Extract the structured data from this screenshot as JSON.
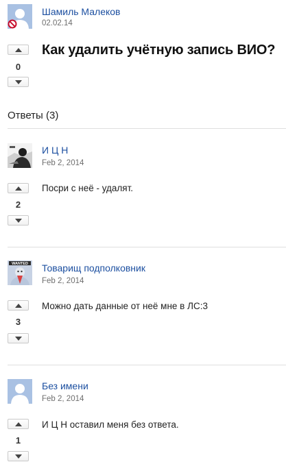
{
  "question": {
    "author": "Шамиль Малеков",
    "date": "02.02.14",
    "votes": "0",
    "title": "Как удалить учётную запись ВИО?"
  },
  "answers_heading": "Ответы (3)",
  "answers": [
    {
      "author": "И Ц Н",
      "date": "Feb 2, 2014",
      "votes": "2",
      "text": "Посри с неё - удалят."
    },
    {
      "author": "Товарищ подполковник",
      "date": "Feb 2, 2014",
      "votes": "3",
      "text": "Можно дать данные от неё мне в ЛС:3",
      "avatar_label": "WANTED"
    },
    {
      "author": "Без имени",
      "date": "Feb 2, 2014",
      "votes": "1",
      "text": "И Ц Н оставил меня без ответа."
    }
  ],
  "colors": {
    "link": "#1c4fa0",
    "avatar_blue": "#a9c1e3",
    "divider": "#dedede"
  }
}
